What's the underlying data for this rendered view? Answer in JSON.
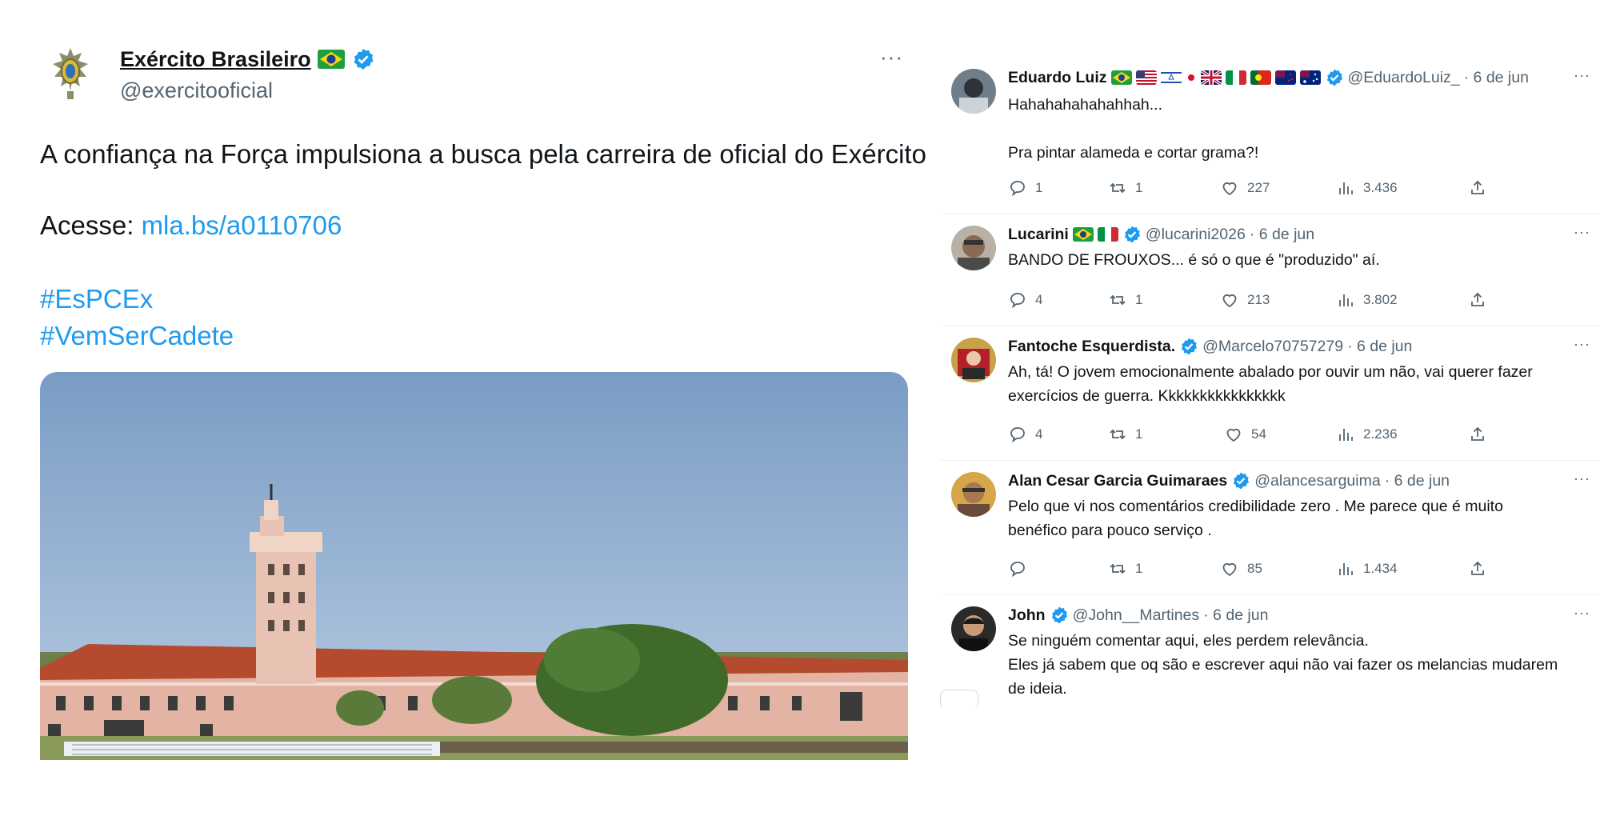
{
  "main_tweet": {
    "author_name": "Exército Brasileiro",
    "author_handle": "@exercitooficial",
    "more": "···",
    "text": "A confiança na Força impulsiona a busca pela carreira de oficial do Exército",
    "access_label": "Acesse: ",
    "link": "mla.bs/a0110706",
    "hashtags": [
      "#EsPCEx",
      "#VemSerCadete"
    ]
  },
  "icons": {
    "reply": "reply-bubble-icon",
    "retweet": "retweet-icon",
    "like": "heart-icon",
    "views": "views-bars-icon",
    "share": "share-upload-icon",
    "verified": "verified-badge-icon"
  },
  "colors": {
    "link": "#1d9bf0",
    "verified": "#1d9bf0",
    "secondary_text": "#536471"
  },
  "replies": [
    {
      "name": "Eduardo Luiz",
      "handle": "@EduardoLuiz_",
      "date": "· 6 de jun",
      "more": "···",
      "lines": [
        "Hahahahahahahhah...",
        "",
        "Pra pintar alameda e cortar grama?!"
      ],
      "counts": {
        "replies": "1",
        "retweets": "1",
        "likes": "227",
        "views": "3.436"
      }
    },
    {
      "name": "Lucarini",
      "handle": "@lucarini2026",
      "date": "· 6 de jun",
      "more": "···",
      "lines": [
        "BANDO DE FROUXOS... é só o que é \"produzido\" aí."
      ],
      "counts": {
        "replies": "4",
        "retweets": "1",
        "likes": "213",
        "views": "3.802"
      }
    },
    {
      "name": "Fantoche Esquerdista.",
      "handle": "@Marcelo70757279",
      "date": "· 6 de jun",
      "more": "···",
      "lines": [
        "Ah, tá! O jovem emocionalmente abalado por ouvir um não, vai querer fazer",
        "exercícios de guerra. Kkkkkkkkkkkkkkkk"
      ],
      "counts": {
        "replies": "4",
        "retweets": "1",
        "likes": "54",
        "views": "2.236"
      }
    },
    {
      "name": "Alan Cesar Garcia Guimaraes",
      "handle": "@alancesarguima",
      "date": "· 6 de jun",
      "more": "···",
      "lines": [
        "Pelo que vi nos comentários credibilidade zero . Me parece que é muito",
        "benéfico para pouco serviço ."
      ],
      "counts": {
        "replies": "",
        "retweets": "1",
        "likes": "85",
        "views": "1.434"
      }
    },
    {
      "name": "John",
      "handle": "@John__Martines",
      "date": "· 6 de jun",
      "more": "···",
      "lines": [
        "Se ninguém comentar aqui, eles perdem relevância.",
        "Eles já sabem que oq são e escrever aqui não vai fazer os melancias mudarem",
        "de ideia."
      ]
    }
  ]
}
